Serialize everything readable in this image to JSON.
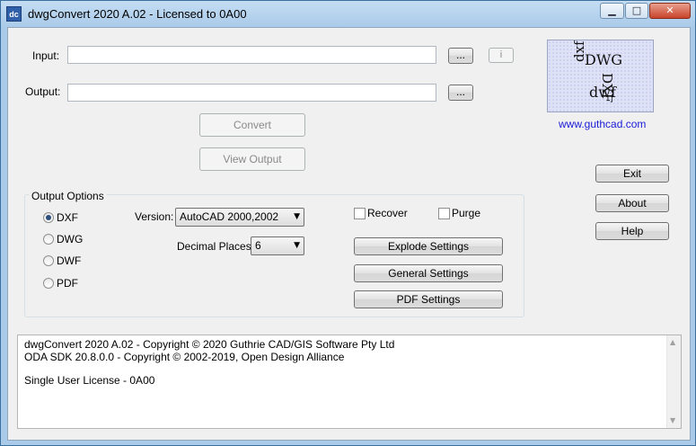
{
  "window": {
    "title": "dwgConvert 2020 A.02 - Licensed to 0A00",
    "app_icon_text": "dc",
    "controls": {
      "minimize": "▁",
      "maximize": "□",
      "close": "✕"
    }
  },
  "inputs": {
    "input_label": "Input:",
    "input_value": "",
    "input_browse": "...",
    "info_button": "i",
    "output_label": "Output:",
    "output_value": "",
    "output_browse": "..."
  },
  "actions": {
    "convert": "Convert",
    "view_output": "View Output"
  },
  "logo": {
    "dwg": "DWG",
    "dxf_right": "DXF",
    "dwf": "dwf",
    "dxf_left": "dxf",
    "link": "www.guthcad.com"
  },
  "side_buttons": {
    "exit": "Exit",
    "about": "About",
    "help": "Help"
  },
  "output_options": {
    "title": "Output Options",
    "formats": [
      "DXF",
      "DWG",
      "DWF",
      "PDF"
    ],
    "selected_format": "DXF",
    "version_label": "Version:",
    "version_value": "AutoCAD 2000,2002",
    "decimal_label": "Decimal Places:",
    "decimal_value": "6",
    "recover_label": "Recover",
    "recover_checked": false,
    "purge_label": "Purge",
    "purge_checked": false,
    "explode_settings": "Explode Settings",
    "general_settings": "General Settings",
    "pdf_settings": "PDF Settings"
  },
  "log": {
    "lines": [
      "dwgConvert 2020 A.02 - Copyright © 2020 Guthrie CAD/GIS Software Pty Ltd",
      "ODA SDK 20.8.0.0 - Copyright © 2002-2019, Open Design Alliance",
      "",
      "Single User License - 0A00"
    ]
  },
  "colors": {
    "link": "#1a1ad8",
    "title_gradient_top": "#c4ddf3",
    "close_button": "#c8432a",
    "client_bg": "#f0f0f0"
  }
}
